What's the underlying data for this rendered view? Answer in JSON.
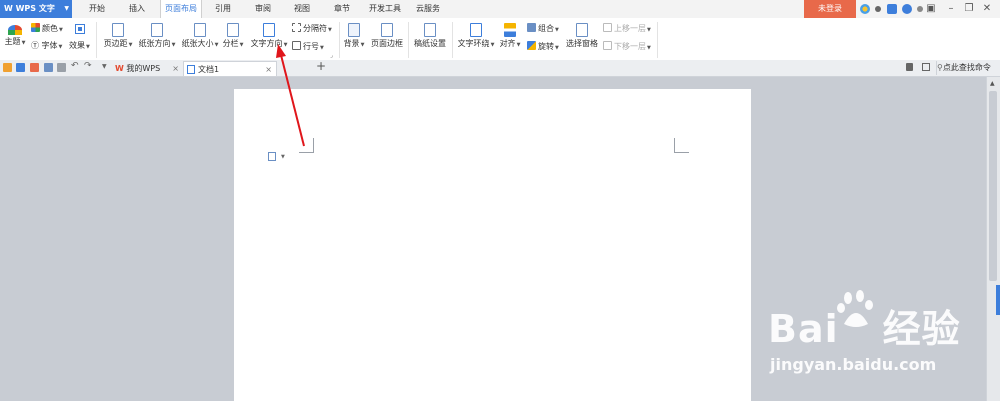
{
  "app_menu": {
    "label": "W WPS 文字"
  },
  "menu_tabs": [
    "开始",
    "插入",
    "页面布局",
    "引用",
    "审阅",
    "视图",
    "章节",
    "开发工具",
    "云服务"
  ],
  "login": "未登录",
  "ribbon": {
    "theme": "主题",
    "color": "颜色",
    "font": "字体",
    "effect": "效果",
    "margins": "页边距",
    "orientation": "纸张方向",
    "size": "纸张大小",
    "columns": "分栏",
    "text_direction": "文字方向",
    "breaks": "分隔符",
    "line_numbers": "行号",
    "background": "背景",
    "page_border": "页面边框",
    "draft_setup": "稿纸设置",
    "wrap_text": "文字环绕",
    "align": "对齐",
    "group": "组合",
    "rotate": "旋转",
    "selection_pane": "选择窗格",
    "bring_forward": "上移一层",
    "send_backward": "下移一层"
  },
  "doc_tabs": {
    "home": "我的WPS",
    "doc1": "文档1"
  },
  "find_command": "点此查找命令",
  "watermark": {
    "logo_left": "Bai",
    "logo_right": "经验",
    "url": "jingyan.baidu.com"
  },
  "colors": {
    "accent": "#3d7edb",
    "login": "#e8694a",
    "arrow": "#e0161b"
  }
}
